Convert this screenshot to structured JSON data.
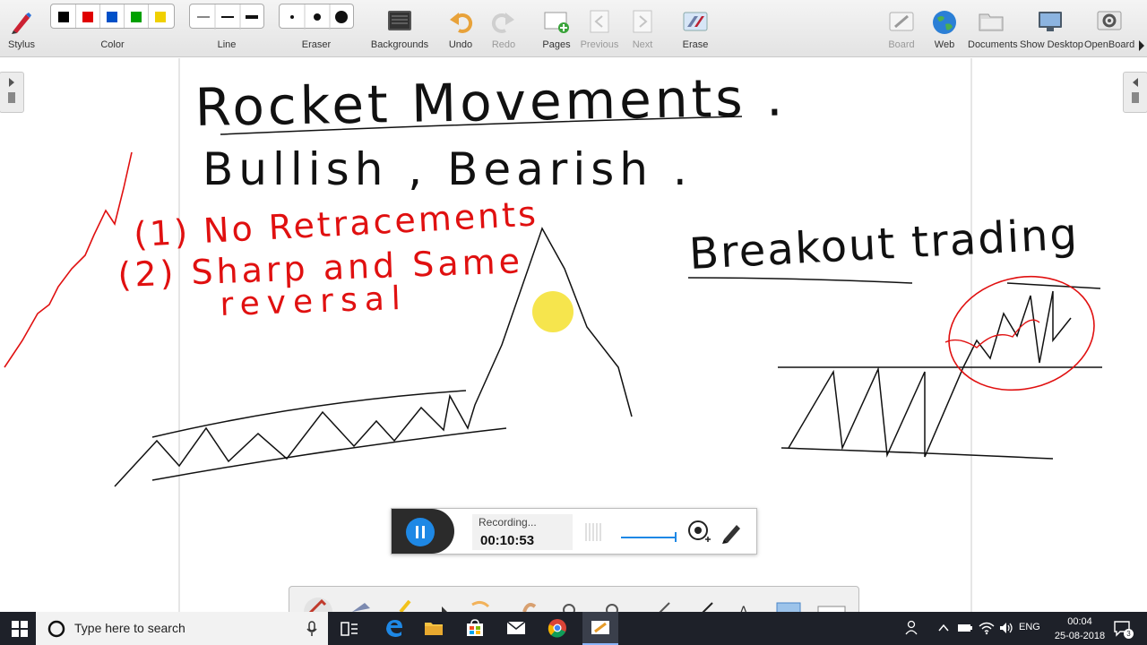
{
  "toolbar": {
    "stylus_label": "Stylus",
    "color_label": "Color",
    "line_label": "Line",
    "eraser_label": "Eraser",
    "backgrounds_label": "Backgrounds",
    "undo_label": "Undo",
    "redo_label": "Redo",
    "pages_label": "Pages",
    "previous_label": "Previous",
    "next_label": "Next",
    "erase_label": "Erase",
    "board_label": "Board",
    "web_label": "Web",
    "documents_label": "Documents",
    "show_desktop_label": "Show Desktop",
    "openboard_label": "OpenBoard",
    "colors": [
      "#000000",
      "#e00000",
      "#0050c8",
      "#00a000",
      "#f0d000"
    ]
  },
  "board": {
    "title": "Rocket Movements .",
    "subtitle": "Bullish , Bearish .",
    "point_1": "(1) No Retracements",
    "point_2": "(2) Sharp and Same",
    "point_2_cont": "reversal",
    "breakout_heading": "Breakout trading",
    "ink_black": "#111111",
    "ink_red": "#e01010",
    "pointer_color": "#f5e23a"
  },
  "recorder": {
    "status": "Recording...",
    "elapsed": "00:10:53"
  },
  "taskbar": {
    "search_placeholder": "Type here to search",
    "time": "00:04",
    "date": "25-08-2018",
    "language": "ENG",
    "notification_count": "3"
  }
}
